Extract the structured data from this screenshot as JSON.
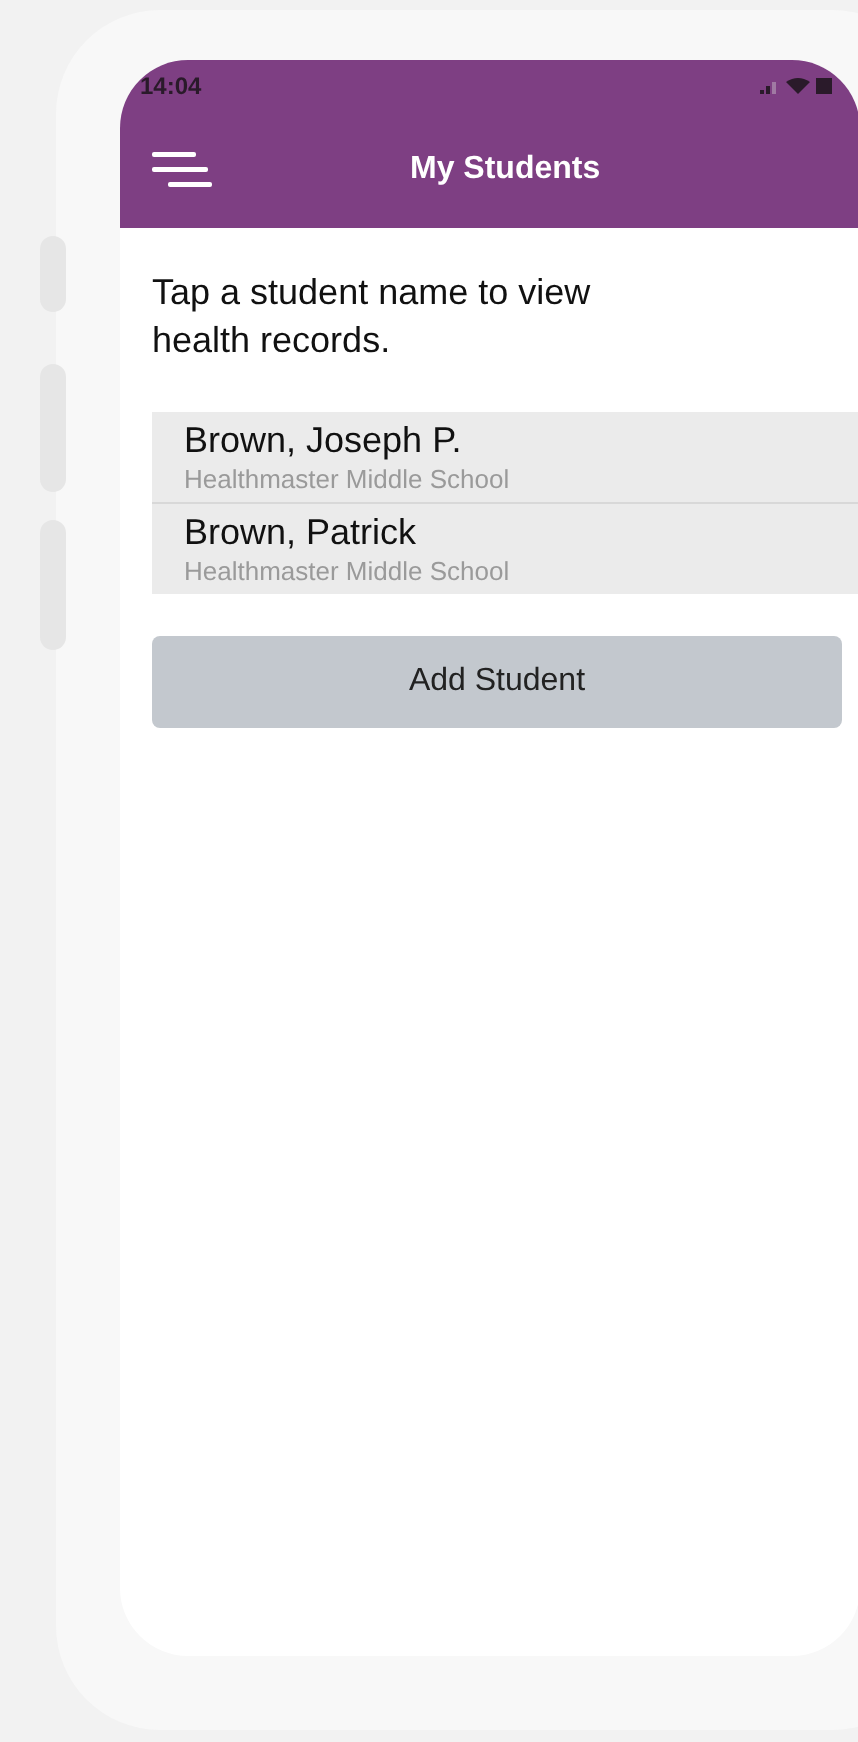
{
  "status_bar": {
    "time": "14:04"
  },
  "header": {
    "title": "My Students"
  },
  "instructions": "Tap a student name to view health records.",
  "students": [
    {
      "name": "Brown, Joseph P.",
      "school": "Healthmaster Middle School"
    },
    {
      "name": "Brown, Patrick",
      "school": "Healthmaster Middle School"
    }
  ],
  "add_button": "Add Student"
}
